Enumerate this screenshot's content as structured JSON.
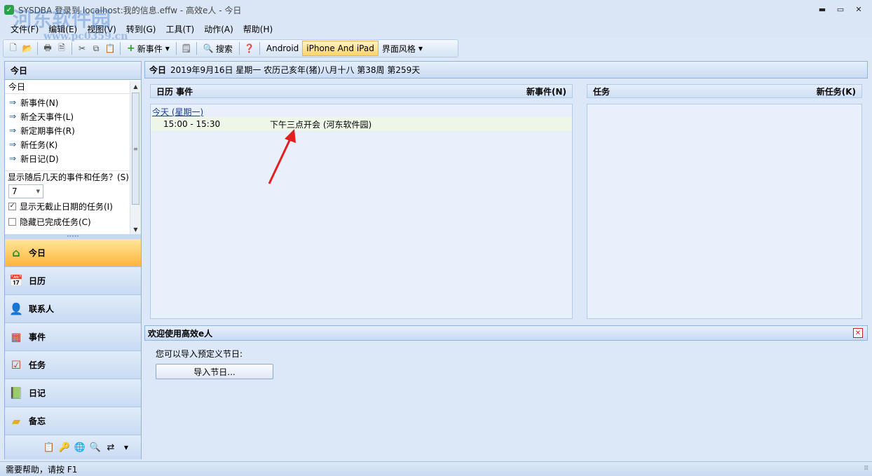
{
  "window": {
    "title": "SYSDBA 登录到 localhost:我的信息.effw - 高效e人 - 今日",
    "minimize_label": "▬",
    "maximize_label": "▭",
    "close_label": "✕"
  },
  "watermark": {
    "text": "河东软件园",
    "sub": "www.pc0359.cn"
  },
  "menu": [
    {
      "label": "文件(F)"
    },
    {
      "label": "编辑(E)"
    },
    {
      "label": "视图(V)"
    },
    {
      "label": "转到(G)"
    },
    {
      "label": "工具(T)"
    },
    {
      "label": "动作(A)"
    },
    {
      "label": "帮助(H)"
    }
  ],
  "toolbar": {
    "new_event": "新事件",
    "search": "搜索",
    "android": "Android",
    "iphone": "iPhone And iPad",
    "ui_style": "界面风格"
  },
  "left": {
    "header": "今日",
    "sub": "今日",
    "quick": [
      {
        "label": "新事件(N)"
      },
      {
        "label": "新全天事件(L)"
      },
      {
        "label": "新定期事件(R)"
      },
      {
        "label": "新任务(K)"
      },
      {
        "label": "新日记(D)"
      }
    ],
    "days_label": "显示随后几天的事件和任务？(S)",
    "days_value": "7",
    "show_no_deadline": "显示无截止日期的任务(I)",
    "hide_completed": "隐藏已完成任务(C)",
    "nav": [
      {
        "label": "今日"
      },
      {
        "label": "日历"
      },
      {
        "label": "联系人"
      },
      {
        "label": "事件"
      },
      {
        "label": "任务"
      },
      {
        "label": "日记"
      },
      {
        "label": "备忘"
      }
    ]
  },
  "today_header": {
    "title": "今日",
    "date": "2019年9月16日 星期一 农历己亥年(猪)八月十八 第38周 第259天"
  },
  "calendar": {
    "header": "日历 事件",
    "new_event_link": "新事件(N)",
    "day_title": "今天 (星期一)",
    "events": [
      {
        "time": "15:00 - 15:30",
        "title": "下午三点开会 (河东软件园)"
      }
    ]
  },
  "tasks": {
    "header": "任务",
    "new_task_link": "新任务(K)"
  },
  "welcome": {
    "header": "欢迎使用高效e人",
    "text": "您可以导入预定义节日:",
    "import_button": "导入节日..."
  },
  "status": {
    "text": "需要帮助，请按 F1"
  }
}
